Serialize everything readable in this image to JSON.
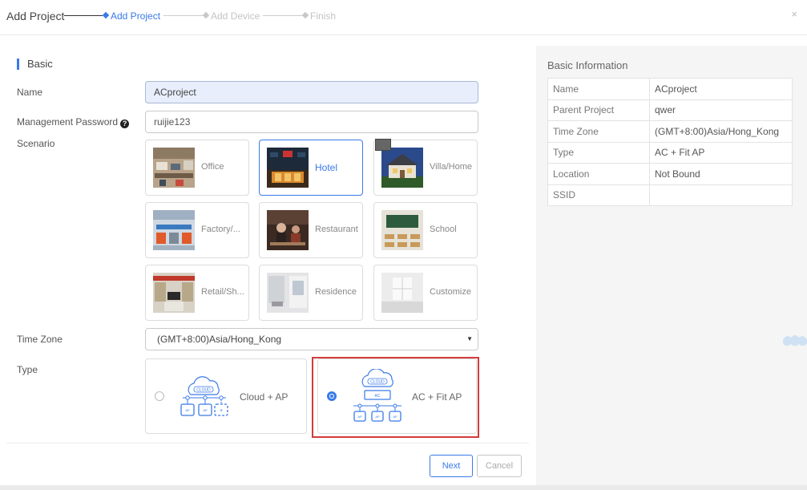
{
  "dialog": {
    "title": "Add Project",
    "close_icon": "×"
  },
  "stepper": {
    "steps": [
      "Add Project",
      "Add Device",
      "Finish"
    ],
    "active_step": 0
  },
  "form": {
    "section_title": "Basic",
    "name_label": "Name",
    "name_value": "ACproject",
    "password_label": "Management Password",
    "password_help_icon": "?",
    "password_value": "ruijie123",
    "scenario_label": "Scenario",
    "scenarios": [
      {
        "label": "Office",
        "selected": false
      },
      {
        "label": "Hotel",
        "selected": true
      },
      {
        "label": "Villa/Home",
        "selected": false
      },
      {
        "label": "Factory/...",
        "selected": false
      },
      {
        "label": "Restaurant",
        "selected": false
      },
      {
        "label": "School",
        "selected": false
      },
      {
        "label": "Retail/Sh...",
        "selected": false
      },
      {
        "label": "Residence",
        "selected": false
      },
      {
        "label": "Customize",
        "selected": false
      }
    ],
    "timezone_label": "Time Zone",
    "timezone_value": "(GMT+8:00)Asia/Hong_Kong",
    "type_label": "Type",
    "types": [
      {
        "label": "Cloud + AP",
        "checked": false,
        "diagram": {
          "cloud": "CLOUD",
          "devices": [
            "AP",
            "AP",
            "+"
          ]
        }
      },
      {
        "label": "AC + Fit AP",
        "checked": true,
        "diagram": {
          "cloud": "CLOUD",
          "controller": "AC",
          "devices": [
            "AP",
            "AP",
            "AP"
          ]
        }
      }
    ],
    "next_label": "Next",
    "cancel_label": "Cancel"
  },
  "info": {
    "title": "Basic Information",
    "rows": [
      {
        "key": "Name",
        "value": "ACproject"
      },
      {
        "key": "Parent Project",
        "value": "qwer"
      },
      {
        "key": "Time Zone",
        "value": "(GMT+8:00)Asia/Hong_Kong"
      },
      {
        "key": "Type",
        "value": "AC + Fit AP"
      },
      {
        "key": "Location",
        "value": "Not Bound"
      },
      {
        "key": "SSID",
        "value": ""
      }
    ]
  },
  "colors": {
    "accent": "#3a7ae8",
    "highlight_frame": "#d23b3b"
  }
}
